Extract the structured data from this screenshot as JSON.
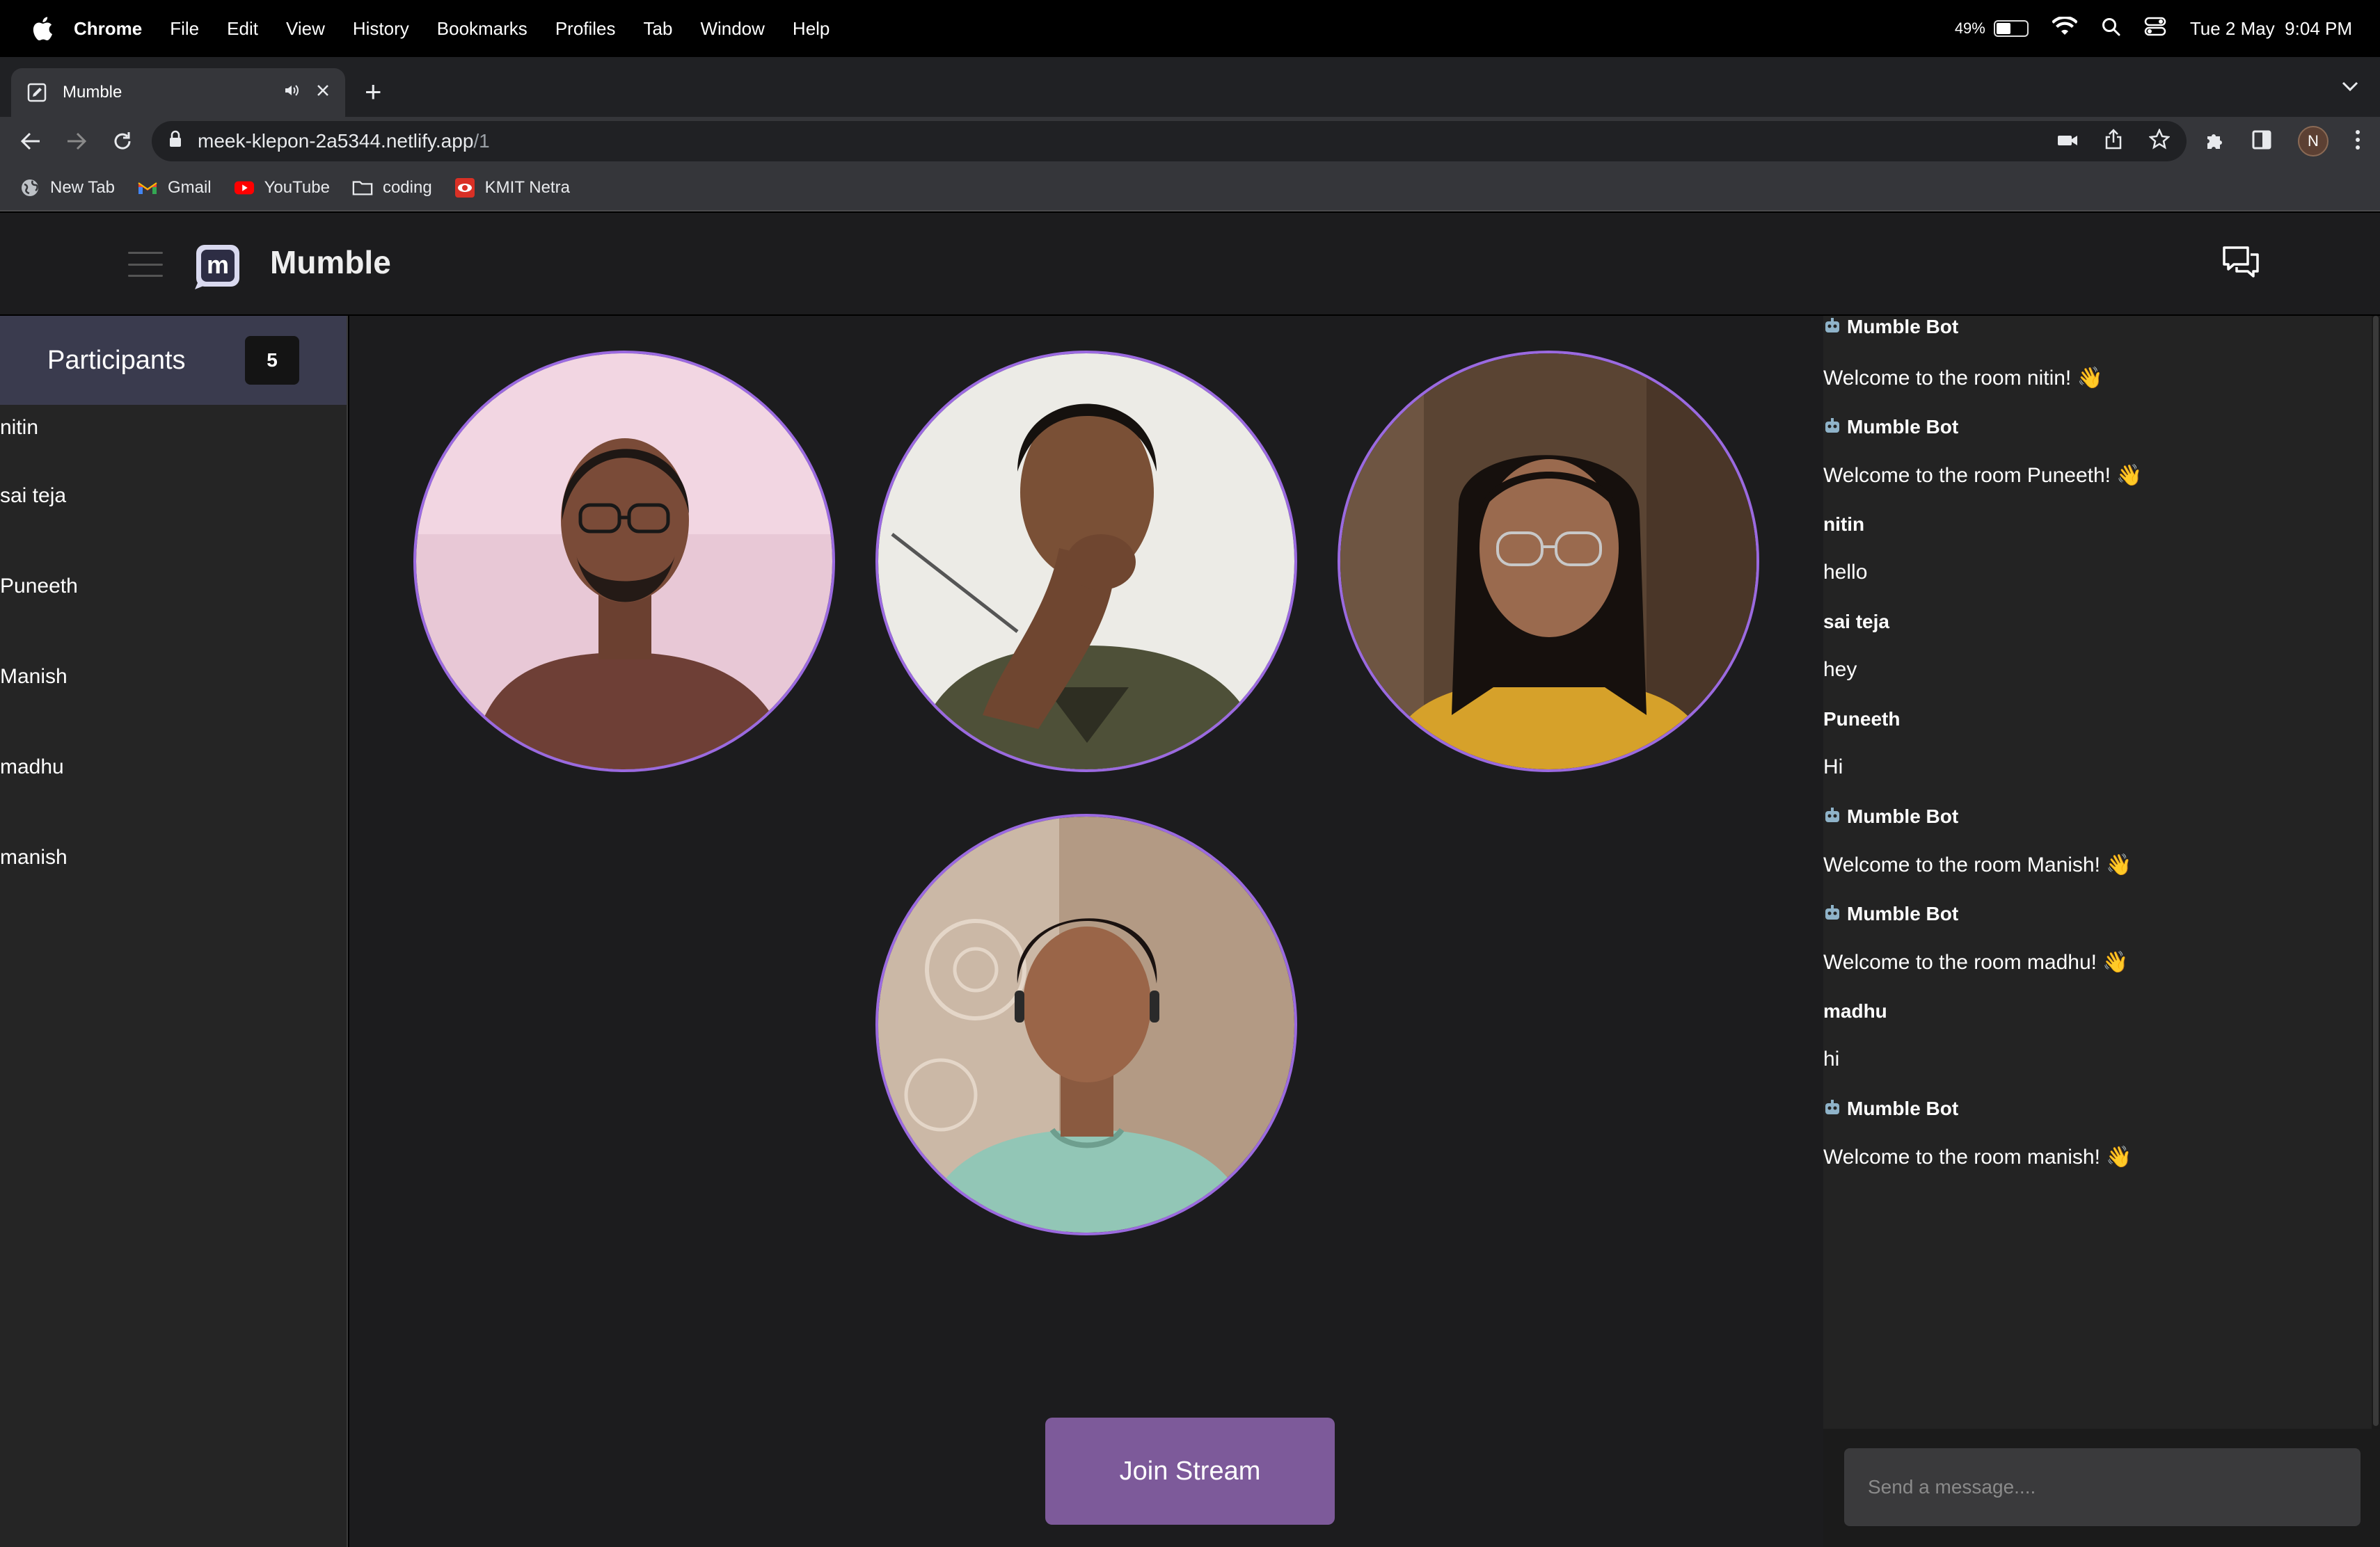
{
  "menubar": {
    "app": "Chrome",
    "items": [
      "File",
      "Edit",
      "View",
      "History",
      "Bookmarks",
      "Profiles",
      "Tab",
      "Window",
      "Help"
    ],
    "battery": "49%",
    "battery_level": 0.49,
    "datetime": "Tue 2 May  9:04 PM"
  },
  "tab": {
    "title": "Mumble"
  },
  "address": {
    "host": "meek-klepon-2a5344.netlify.app",
    "path": "/1"
  },
  "profile": {
    "initial": "N"
  },
  "bookmarks": [
    {
      "label": "New Tab",
      "icon": "globe-icon"
    },
    {
      "label": "Gmail",
      "icon": "gmail-icon"
    },
    {
      "label": "YouTube",
      "icon": "youtube-icon"
    },
    {
      "label": "coding",
      "icon": "folder-icon"
    },
    {
      "label": "KMIT Netra",
      "icon": "netra-icon"
    }
  ],
  "app": {
    "name": "Mumble",
    "logo_letter": "m",
    "accent": "#9b6ae0",
    "button_color": "#7d5a9a"
  },
  "participants": {
    "title": "Participants",
    "count": "5",
    "list": [
      "nitin",
      "sai teja",
      "Puneeth",
      "Manish",
      "madhu",
      "manish"
    ]
  },
  "stage": {
    "join_label": "Join Stream"
  },
  "chat": {
    "messages": [
      {
        "author": "Mumble Bot",
        "bot": true,
        "text": "Welcome to the room nitin! 👋"
      },
      {
        "author": "Mumble Bot",
        "bot": true,
        "text": "Welcome to the room Puneeth! 👋"
      },
      {
        "author": "nitin",
        "bot": false,
        "text": "hello"
      },
      {
        "author": "sai teja",
        "bot": false,
        "text": "hey"
      },
      {
        "author": "Puneeth",
        "bot": false,
        "text": "Hi"
      },
      {
        "author": "Mumble Bot",
        "bot": true,
        "text": "Welcome to the room Manish! 👋"
      },
      {
        "author": "Mumble Bot",
        "bot": true,
        "text": "Welcome to the room madhu! 👋"
      },
      {
        "author": "madhu",
        "bot": false,
        "text": "hi"
      },
      {
        "author": "Mumble Bot",
        "bot": true,
        "text": "Welcome to the room manish! 👋"
      }
    ],
    "placeholder": "Send a message...."
  }
}
